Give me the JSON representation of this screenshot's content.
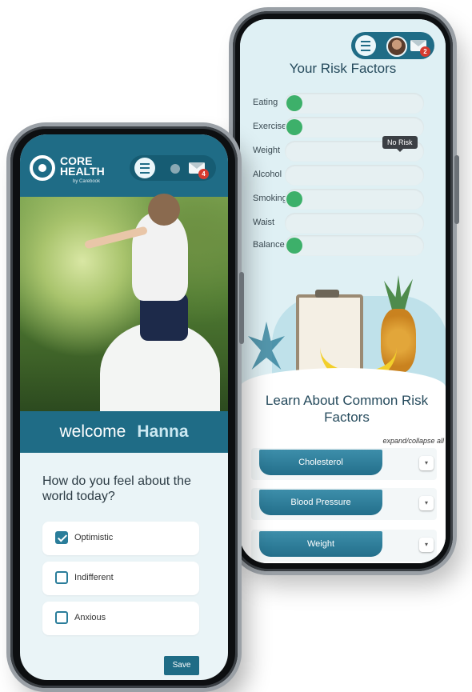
{
  "back_screen": {
    "header": {
      "mail_badge": "2"
    },
    "title": "Your Risk Factors",
    "risk_factors": [
      {
        "label": "Eating",
        "status": "green"
      },
      {
        "label": "Exercise",
        "status": "green"
      },
      {
        "label": "Weight",
        "status": "none"
      },
      {
        "label": "Alcohol",
        "status": "none"
      },
      {
        "label": "Smoking",
        "status": "green"
      },
      {
        "label": "Waist",
        "status": "none"
      },
      {
        "label": "Balance",
        "status": "green"
      }
    ],
    "tooltip": "No Risk",
    "learn_title": "Learn About Common Risk Factors",
    "expand_collapse": "expand/collapse all",
    "accordions": [
      {
        "label": "Cholesterol"
      },
      {
        "label": "Blood Pressure"
      },
      {
        "label": "Weight"
      }
    ],
    "toggle_symbol": "▾"
  },
  "front_screen": {
    "logo": {
      "line1": "CORE",
      "line2": "HEALTH",
      "sub": "by Carebook"
    },
    "header": {
      "mail_badge": "4"
    },
    "welcome": {
      "greeting": "welcome",
      "name": "Hanna"
    },
    "question": "How do you feel about the world today?",
    "options": [
      {
        "label": "Optimistic",
        "checked": true
      },
      {
        "label": "Indifferent",
        "checked": false
      },
      {
        "label": "Anxious",
        "checked": false
      }
    ],
    "save_label": "Save"
  },
  "colors": {
    "brand": "#1f6c86",
    "risk_ok": "#3db06a",
    "badge": "#d63a2f"
  }
}
